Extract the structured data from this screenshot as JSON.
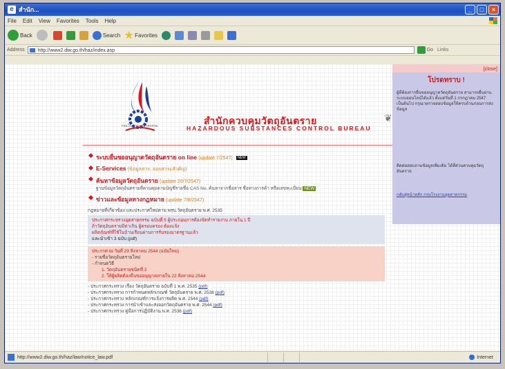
{
  "window": {
    "title": "สำนัก...",
    "buttons": [
      "_",
      "□",
      "×"
    ]
  },
  "menu": [
    "File",
    "Edit",
    "View",
    "Favorites",
    "Tools",
    "Help"
  ],
  "toolbar": {
    "back": "Back",
    "search": "Search",
    "favorites": "Favorites"
  },
  "address": {
    "label": "Address",
    "url": "http://www2.diw.go.th/haz/index.asp",
    "go": "Go",
    "links": "Links"
  },
  "header": {
    "thai_title": "สำนักควบคุมวัตถุอันตราย",
    "english_title": "HAZARDOUS SUBSTANCES CONTROL BUREAU",
    "logo_caption": "กรมโรงงานอุตสาหกรรม"
  },
  "items": [
    {
      "title": "ระบบยื่นขออนุญาตวัตถุอันตราย on line",
      "tag": "(update 7/2547)",
      "badge": "NEW",
      "desc": ""
    },
    {
      "title": "E-Services",
      "tag": "(ข้อมูลสาร, ออกสาระสำคัญ)",
      "badge": "",
      "desc": ""
    },
    {
      "title": "ค้นหาข้อมูลวัตถุอันตราย",
      "tag": "(update 20/7/2547)",
      "badge": "",
      "desc": "ฐานข้อมูลวัตถุอันตรายที่ควบคุมตามบัญชีรายชื่อ CAS No. ค้นหาจากชื่อสาร ชื่อทางการค้า หรือเลขทะเบียน",
      "highlight": "NEW"
    },
    {
      "title": "ข่าวและข้อมูลทางกฎหมาย",
      "tag": "(update 7/8/2547)",
      "badge": "",
      "desc": ""
    }
  ],
  "law_note": "กฎหมายที่เกี่ยวข้อง และประกาศใหม่ตาม พรบ.วัตถุอันตราย พ.ศ. 2535",
  "blue_box": {
    "line1": "ประกาศกระทรวงอุตสาหกรรม ฉบับที่ 5 ผู้ประกอบการต้องจัดทำรายงาน ภายใน 1 ปี",
    "line2": "ถ้าวัตถุอันตรายมีค่าเกิน ผู้ครอบครอง ต้องแจ้ง",
    "line3": "ผลิตภัณฑ์ที่ใช้ในบ้านเรือนผ่านการรับรองมาตรฐานแล้ว",
    "line4": "และนำเข้า 3 ฉบับ (pdf)"
  },
  "pink_box": {
    "heading": "ประกาศ ณ วันที่ 29 สิงหาคม 2544 (ฉบับใหม่)",
    "lines": [
      "- รายชื่อวัตถุอันตรายใหม่",
      "- กำหนดวิธี",
      "1. วัตถุอันตรายชนิดที่ 3",
      "2. ให้ผู้ผลิตต้องยื่นขออนุญาตภายใน 22 สิงหาคม 2544"
    ]
  },
  "list": [
    {
      "text": "- ประกาศกระทรวง เรื่อง วัตถุอันตราย ฉบับที่ 1 พ.ศ. 2535",
      "link": "(pdf)"
    },
    {
      "text": "- ประกาศกระทรวง การกำหนดหลักเกณฑ์ วัตถุอันตราย พ.ศ. 2538",
      "link": "(pdf)"
    },
    {
      "text": "- ประกาศกระทรวง หลักเกณฑ์การแจ้งการผลิต พ.ศ. 2544",
      "link": "(pdf)"
    },
    {
      "text": "- ประกาศกระทรวง การนำเข้าและส่งออกวัตถุอันตราย พ.ศ. 2544",
      "link": "(pdf)"
    },
    {
      "text": "- ประกาศกระทรวง คู่มือการปฏิบัติงาน พ.ศ. 2536",
      "link": "(pdf)"
    }
  ],
  "sidebar": {
    "close": "[close]",
    "heading": "โปรดทราบ !",
    "text1": "ผู้ที่ต้องการยื่นขออนุญาตวัตถุอันตราย สามารถยื่นผ่านระบบออนไลน์ได้แล้ว ตั้งแต่วันที่ 1 กรกฎาคม 2547 เป็นต้นไป กรุณาตรวจสอบข้อมูลให้ครบถ้วนก่อนการส่งข้อมูล",
    "text2": "ติดต่อสอบถามข้อมูลเพิ่มเติม ได้ที่ส่วนควบคุมวัตถุอันตราย",
    "link": "กลับสู่หน้าหลัก กรมโรงงานอุตสาหกรรม"
  },
  "status": {
    "url": "http://www2.diw.go.th/haz/law/notice_law.pdf",
    "zone": "Internet"
  }
}
